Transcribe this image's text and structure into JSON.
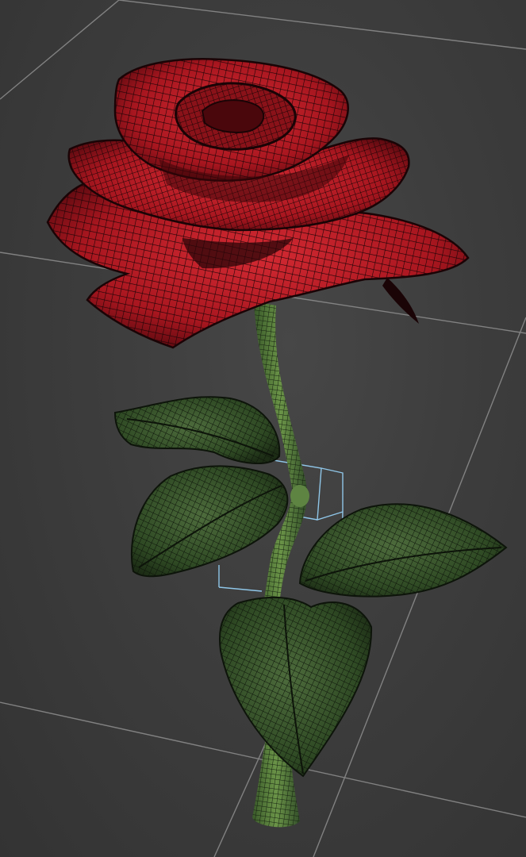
{
  "viewport": {
    "background": "#3d3d3d",
    "grid_color": "#8e8e8e",
    "selection_color": "#8fc6e8"
  },
  "model": {
    "bloom_color": "#c2202a",
    "bloom_shadow": "#5a0b10",
    "leaf_color": "#2f4a24",
    "stem_color": "#4f7a3a",
    "wire_color": "#000000"
  }
}
